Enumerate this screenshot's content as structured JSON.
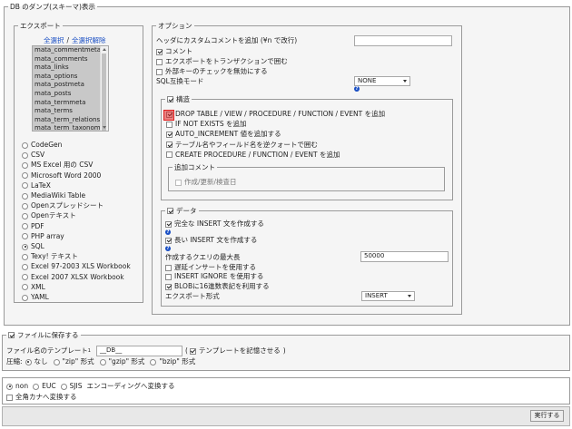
{
  "main_legend": "DB のダンプ(スキーマ)表示",
  "export": {
    "legend": "エクスポート",
    "select_all": "全選択",
    "separator": "/",
    "deselect_all": "全選択解除",
    "tables": [
      "mata_commentmeta",
      "mata_comments",
      "mata_links",
      "mata_options",
      "mata_postmeta",
      "mata_posts",
      "mata_termmeta",
      "mata_terms",
      "mata_term_relationships",
      "mata_term_taxonomy"
    ],
    "formats": [
      "CodeGen",
      "CSV",
      "MS Excel 用の CSV",
      "Microsoft Word 2000",
      "LaTeX",
      "MediaWiki Table",
      "Openスプレッドシート",
      "Openテキスト",
      "PDF",
      "PHP array",
      "SQL",
      "Texy! テキスト",
      "Excel 97-2003 XLS Workbook",
      "Excel 2007 XLSX Workbook",
      "XML",
      "YAML"
    ],
    "selected_format": "SQL"
  },
  "options": {
    "legend": "オプション",
    "header_comment_label": "ヘッダにカスタムコメントを追加 (¥n で改行)",
    "header_comment_value": "",
    "comment": "コメント",
    "transaction": "エクスポートをトランザクションで囲む",
    "disable_fk": "外部キーのチェックを無効にする",
    "sql_compat_label": "SQL互換モード",
    "sql_compat_value": "NONE",
    "structure": {
      "legend": "構造",
      "items": [
        "DROP TABLE / VIEW / PROCEDURE / FUNCTION / EVENT を追加",
        "IF NOT EXISTS を追加",
        "AUTO_INCREMENT 値を追加する",
        "テーブル名やフィールド名を逆クォートで囲む",
        "CREATE PROCEDURE / FUNCTION / EVENT を追加"
      ],
      "checked": [
        true,
        false,
        true,
        true,
        false
      ],
      "extra_comment_legend": "追加コメント",
      "extra_comment_item": "作成/更新/検査日"
    },
    "data": {
      "legend": "データ",
      "complete_insert": "完全な INSERT 文を作成する",
      "extended_insert": "長い INSERT 文を作成する",
      "max_query_label": "作成するクエリの最大長",
      "max_query_value": "50000",
      "delayed_insert": "遅延インサートを使用する",
      "insert_ignore": "INSERT IGNORE を使用する",
      "hex_blob": "BLOBに16進数表記を利用する",
      "export_type_label": "エクスポート形式",
      "export_type_value": "INSERT"
    }
  },
  "save": {
    "legend": "ファイルに保存する",
    "template_label": "ファイル名のテンプレート",
    "template_sup": "1",
    "template_value": "__DB__",
    "remember_label": "テンプレートを記憶させる",
    "paren_open": "(",
    "paren_close": ")",
    "compression_label": "圧縮:",
    "compression_options": [
      "なし",
      "\"zip\" 形式",
      "\"gzip\" 形式",
      "\"bzip\" 形式"
    ]
  },
  "encoding": {
    "options": [
      "non",
      "EUC",
      "SJIS"
    ],
    "convert_label": "エンコーディングへ変換する",
    "zenkaku": "全角カナへ変換する"
  },
  "execute_button": "実行する",
  "help_glyph": "?"
}
